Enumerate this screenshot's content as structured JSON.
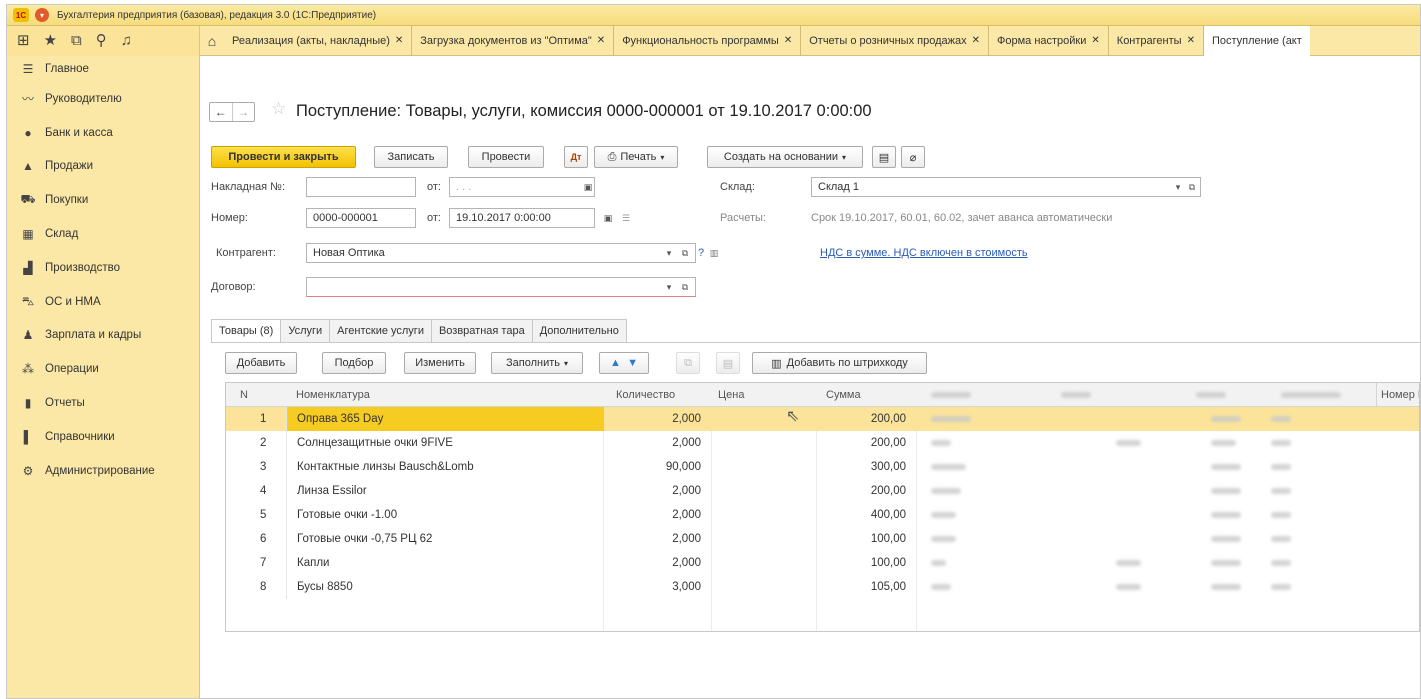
{
  "window": {
    "title": "Бухгалтерия предприятия (базовая), редакция 3.0  (1С:Предприятие)",
    "logo": "1С"
  },
  "top_icons": [
    "apps-grid-icon",
    "star-icon",
    "history-icon",
    "search-icon",
    "bell-icon"
  ],
  "tabs": [
    {
      "label": "Реализация (акты, накладные)"
    },
    {
      "label": "Загрузка документов из \"Оптима\""
    },
    {
      "label": "Функциональность программы"
    },
    {
      "label": "Отчеты о розничных продажах"
    },
    {
      "label": "Форма настройки"
    },
    {
      "label": "Контрагенты"
    },
    {
      "label": "Поступление (акт"
    }
  ],
  "sidebar": {
    "items": [
      {
        "label": "Главное",
        "icon": "menu-icon"
      },
      {
        "label": "Руководителю",
        "icon": "chart-line-icon"
      },
      {
        "label": "Банк и касса",
        "icon": "coin-icon"
      },
      {
        "label": "Продажи",
        "icon": "bag-icon"
      },
      {
        "label": "Покупки",
        "icon": "cart-icon"
      },
      {
        "label": "Склад",
        "icon": "warehouse-icon"
      },
      {
        "label": "Производство",
        "icon": "factory-icon"
      },
      {
        "label": "ОС и НМА",
        "icon": "truck-icon"
      },
      {
        "label": "Зарплата и кадры",
        "icon": "person-icon"
      },
      {
        "label": "Операции",
        "icon": "operations-icon"
      },
      {
        "label": "Отчеты",
        "icon": "report-icon"
      },
      {
        "label": "Справочники",
        "icon": "book-icon"
      },
      {
        "label": "Администрирование",
        "icon": "gear-icon"
      }
    ]
  },
  "document": {
    "title": "Поступление: Товары, услуги, комиссия 0000-000001 от 19.10.2017 0:00:00",
    "toolbar": {
      "post_close": "Провести и закрыть",
      "save": "Записать",
      "post": "Провести",
      "print": "Печать",
      "create_basis": "Создать на основании"
    },
    "fields": {
      "invoice_label": "Накладная  №:",
      "invoice_value": "",
      "invoice_date_label": "от:",
      "invoice_date_value": ". . .",
      "number_label": "Номер:",
      "number_value": "0000-000001",
      "date_label": "от:",
      "date_value": "19.10.2017  0:00:00",
      "warehouse_label": "Склад:",
      "warehouse_value": "Склад 1",
      "settlements_label": "Расчеты:",
      "settlements_value": "Срок 19.10.2017, 60.01, 60.02, зачет аванса автоматически",
      "counterparty_label": "Контрагент:",
      "counterparty_value": "Новая Оптика",
      "help_mark": "?",
      "vat_link": "НДС в сумме. НДС включен в стоимость",
      "contract_label": "Договор:",
      "contract_value": ""
    },
    "subtabs": [
      "Товары (8)",
      "Услуги",
      "Агентские услуги",
      "Возвратная тара",
      "Дополнительно"
    ],
    "table_toolbar": {
      "add": "Добавить",
      "select": "Подбор",
      "change": "Изменить",
      "fill": "Заполнить",
      "barcode": "Добавить по штрихкоду"
    },
    "columns": {
      "n": "N",
      "name": "Номенклатура",
      "qty": "Количество",
      "price": "Цена",
      "sum": "Сумма",
      "gtd": "Номер Г"
    },
    "rows": [
      {
        "n": "1",
        "name": "Оправа 365 Day",
        "qty": "2,000",
        "price": "",
        "sum": "200,00"
      },
      {
        "n": "2",
        "name": "Солнцезащитные очки 9FIVE",
        "qty": "2,000",
        "price": "",
        "sum": "200,00"
      },
      {
        "n": "3",
        "name": "Контактные линзы Bausch&Lomb",
        "qty": "90,000",
        "price": "",
        "sum": "300,00"
      },
      {
        "n": "4",
        "name": "Линза Essilor",
        "qty": "2,000",
        "price": "",
        "sum": "200,00"
      },
      {
        "n": "5",
        "name": "Готовые очки -1.00",
        "qty": "2,000",
        "price": "",
        "sum": "400,00"
      },
      {
        "n": "6",
        "name": "Готовые очки -0,75 РЦ 62",
        "qty": "2,000",
        "price": "",
        "sum": "100,00"
      },
      {
        "n": "7",
        "name": "Капли",
        "qty": "2,000",
        "price": "",
        "sum": "100,00"
      },
      {
        "n": "8",
        "name": "Бусы 8850",
        "qty": "3,000",
        "price": "",
        "sum": "105,00"
      }
    ]
  },
  "colors": {
    "accent": "#f2c100",
    "panel": "#fbe8a6",
    "selected_row": "#fbe49a",
    "link": "#2a5cb8"
  }
}
